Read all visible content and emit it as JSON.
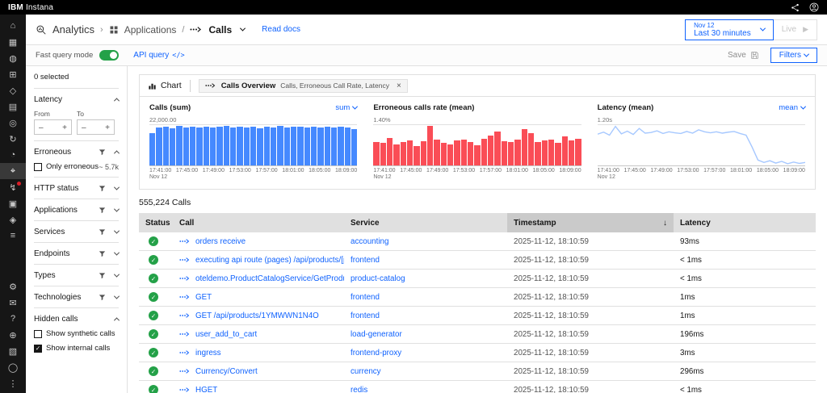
{
  "topbar": {
    "brand_bold": "IBM",
    "brand_rest": "Instana"
  },
  "rail": {
    "items": [
      {
        "name": "home",
        "glyph": "⌂",
        "group": "top"
      },
      {
        "name": "dashboards",
        "glyph": "▦",
        "group": "top"
      },
      {
        "name": "websites",
        "glyph": "◍",
        "group": "top"
      },
      {
        "name": "applications",
        "glyph": "⊞",
        "group": "top"
      },
      {
        "name": "kubernetes",
        "glyph": "◇",
        "group": "top"
      },
      {
        "name": "infrastructure",
        "glyph": "▤",
        "group": "top"
      },
      {
        "name": "synthetic-monitoring",
        "glyph": "◎",
        "group": "top"
      },
      {
        "name": "automation",
        "glyph": "↻",
        "group": "top"
      },
      {
        "name": "service-levels",
        "glyph": "◔",
        "group": "top"
      },
      {
        "name": "analytics",
        "glyph": "⌖",
        "group": "top",
        "active": true
      },
      {
        "name": "events",
        "glyph": "↯",
        "group": "top",
        "badge": true
      },
      {
        "name": "incidents",
        "glyph": "▣",
        "group": "top"
      },
      {
        "name": "integrations",
        "glyph": "◈",
        "group": "top"
      },
      {
        "name": "logs",
        "glyph": "≡",
        "group": "top"
      },
      {
        "name": "settings",
        "glyph": "⚙",
        "group": "bottom"
      },
      {
        "name": "messages",
        "glyph": "✉",
        "group": "bottom"
      },
      {
        "name": "help",
        "glyph": "?",
        "group": "bottom"
      },
      {
        "name": "add",
        "glyph": "⊕",
        "group": "bottom"
      },
      {
        "name": "resources",
        "glyph": "▧",
        "group": "bottom"
      },
      {
        "name": "profile",
        "glyph": "◯",
        "group": "bottom"
      },
      {
        "name": "more",
        "glyph": "⋮",
        "group": "bottom"
      }
    ]
  },
  "header": {
    "analytics": "Analytics",
    "crumb_sep": "›",
    "applications": "Applications",
    "slash": "/",
    "calls": "Calls",
    "read_docs": "Read docs",
    "time_line1": "Nov 12",
    "time_line2": "Last 30 minutes",
    "live": "Live",
    "live_play": "▶"
  },
  "toolbar": {
    "fast_query": "Fast query mode",
    "api_query": "API query",
    "api_query_icon": "</>",
    "save": "Save",
    "filters": "Filters"
  },
  "filters": {
    "selected": "0 selected",
    "latency": {
      "from": "From",
      "to": "To"
    },
    "erroneous": {
      "checkbox": "Only erroneous",
      "count": "~ 5.7k"
    },
    "hidden": {
      "synthetic": "Show synthetic calls",
      "internal": "Show internal calls"
    },
    "sections": [
      {
        "label": "Latency"
      },
      {
        "label": "Erroneous"
      },
      {
        "label": "HTTP status"
      },
      {
        "label": "Applications"
      },
      {
        "label": "Services"
      },
      {
        "label": "Endpoints"
      },
      {
        "label": "Types"
      },
      {
        "label": "Technologies"
      },
      {
        "label": "Hidden calls"
      }
    ]
  },
  "chart_panel": {
    "tab": "Chart",
    "pill_title": "Calls Overview",
    "pill_subtitle": "Calls, Erroneous Call Rate, Latency",
    "close": "×"
  },
  "chart_data": [
    {
      "type": "bar",
      "title": "Calls (sum)",
      "aggregation": "sum",
      "y_top_label": "22,000.00",
      "ylim": [
        0,
        22000
      ],
      "color": "#4589ff",
      "x_ticks": [
        "17:41:00",
        "17:45:00",
        "17:49:00",
        "17:53:00",
        "17:57:00",
        "18:01:00",
        "18:05:00",
        "18:09:00"
      ],
      "x_start_sub": "Nov 12",
      "values": [
        17600,
        20900,
        21200,
        20100,
        21400,
        20600,
        21000,
        20800,
        21300,
        20500,
        21100,
        21500,
        20700,
        21000,
        20900,
        21300,
        20400,
        21100,
        20800,
        21400,
        20900,
        21000,
        21200,
        20600,
        21300,
        20900,
        21100,
        20500,
        21200,
        20800,
        19900
      ]
    },
    {
      "type": "bar",
      "title": "Erroneous calls rate (mean)",
      "y_top_label": "1.40%",
      "ylim": [
        0,
        1.4
      ],
      "color": "#fa4d56",
      "x_ticks": [
        "17:41:00",
        "17:45:00",
        "17:49:00",
        "17:53:00",
        "17:57:00",
        "18:01:00",
        "18:05:00",
        "18:09:00"
      ],
      "x_start_sub": "Nov 12",
      "values": [
        0.82,
        0.78,
        0.94,
        0.72,
        0.8,
        0.88,
        0.68,
        0.84,
        1.38,
        0.9,
        0.78,
        0.74,
        0.86,
        0.9,
        0.8,
        0.7,
        0.92,
        1.05,
        1.18,
        0.84,
        0.8,
        0.9,
        1.27,
        1.12,
        0.8,
        0.86,
        0.9,
        0.78,
        1.0,
        0.88,
        0.92
      ]
    },
    {
      "type": "line",
      "title": "Latency (mean)",
      "aggregation": "mean",
      "y_top_label": "1.20s",
      "ylim": [
        0,
        1.2
      ],
      "color": "#a6c8ff",
      "x_ticks": [
        "17:41:00",
        "17:45:00",
        "17:49:00",
        "17:53:00",
        "17:57:00",
        "18:01:00",
        "18:05:00",
        "18:09:00"
      ],
      "x_start_sub": "Nov 12",
      "values": [
        0.93,
        0.99,
        0.9,
        1.16,
        0.94,
        1.02,
        0.92,
        1.1,
        0.96,
        0.98,
        1.03,
        0.95,
        1.0,
        0.97,
        0.95,
        1.01,
        0.96,
        1.06,
        1.0,
        0.97,
        1.0,
        0.96,
        0.99,
        1.01,
        0.95,
        0.9,
        0.55,
        0.16,
        0.09,
        0.14,
        0.07,
        0.12,
        0.05,
        0.1,
        0.06,
        0.09
      ]
    }
  ],
  "table": {
    "count": "555,224 Calls",
    "sort_icon": "↓",
    "columns": [
      "Status",
      "Call",
      "Service",
      "Timestamp",
      "Latency"
    ],
    "rows": [
      {
        "call": "orders receive",
        "service": "accounting",
        "timestamp": "2025-11-12, 18:10:59",
        "latency": "93ms"
      },
      {
        "call": "executing api route (pages) /api/products/[productId]",
        "service": "frontend",
        "timestamp": "2025-11-12, 18:10:59",
        "latency": "< 1ms"
      },
      {
        "call": "oteldemo.ProductCatalogService/GetProduct",
        "service": "product-catalog",
        "timestamp": "2025-11-12, 18:10:59",
        "latency": "< 1ms"
      },
      {
        "call": "GET",
        "service": "frontend",
        "timestamp": "2025-11-12, 18:10:59",
        "latency": "1ms"
      },
      {
        "call": "GET /api/products/1YMWWN1N4O",
        "service": "frontend",
        "timestamp": "2025-11-12, 18:10:59",
        "latency": "1ms"
      },
      {
        "call": "user_add_to_cart",
        "service": "load-generator",
        "timestamp": "2025-11-12, 18:10:59",
        "latency": "196ms"
      },
      {
        "call": "ingress",
        "service": "frontend-proxy",
        "timestamp": "2025-11-12, 18:10:59",
        "latency": "3ms"
      },
      {
        "call": "Currency/Convert",
        "service": "currency",
        "timestamp": "2025-11-12, 18:10:59",
        "latency": "296ms"
      },
      {
        "call": "HGET",
        "service": "redis",
        "timestamp": "2025-11-12, 18:10:59",
        "latency": "< 1ms"
      }
    ]
  }
}
